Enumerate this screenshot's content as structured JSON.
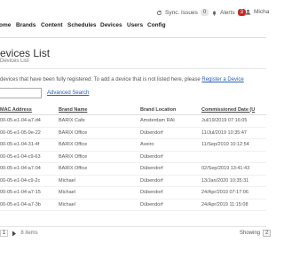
{
  "topbar": {
    "sync_label": "Sync. Issues",
    "sync_count": "0",
    "alerts_label": "Alerts",
    "alerts_count": "3",
    "user_name": "Micha"
  },
  "nav": [
    "ome",
    "Brands",
    "Content",
    "Schedules",
    "Devices",
    "Users",
    "Config"
  ],
  "page": {
    "title": "evices List",
    "breadcrumb": "Devices List",
    "info_text": "devices that have been fully registered. To add a device that is not listed here, please ",
    "info_link": "Register a Device",
    "search_placeholder": "",
    "advanced_search": "Advanced Search"
  },
  "table": {
    "headers": [
      "MAC Address",
      "Brand Name",
      "Brand Location",
      "Commissioned Date (U"
    ],
    "rows": [
      [
        "00-05-e1-04-a7-d4",
        "BARIX Cafe",
        "Amsterdam RAI",
        "Jul/19/2019 07:16:05"
      ],
      [
        "00-05-e1-05-9e-22",
        "BARIX Office",
        "Dübendorf",
        "11/Jul/2019 10:35:47"
      ],
      [
        "00-05-e1-04-31-4f",
        "BARIX Office",
        "Aveiro",
        "11/Sep/2019 10:12:54"
      ],
      [
        "00-05-e1-04-c9-63",
        "BARIX Office",
        "Dübendorf",
        ""
      ],
      [
        "00-05-e1-04-a7-04",
        "BARIX Office",
        "Dübendorf",
        "02/Sep/2019 13:41:43"
      ],
      [
        "00-05-e1-04-c9-2c",
        "Michael",
        "Dübendorf",
        "13/Jan/2020 10:35:31"
      ],
      [
        "00-05-e1-04-a7-15",
        "Michael",
        "Dübendorf",
        "24/Apr/2019 07:17:06"
      ],
      [
        "00-05-e1-04-a7-3b",
        "Michael",
        "Dübendorf",
        "24/Apr/2019 11:15:08"
      ]
    ]
  },
  "footer": {
    "page_number": "1",
    "items_label": "8 items",
    "showing_label": "Showing",
    "page_size": "2"
  },
  "colors": {
    "link": "#2a5db0",
    "alert_badge": "#c62828"
  }
}
